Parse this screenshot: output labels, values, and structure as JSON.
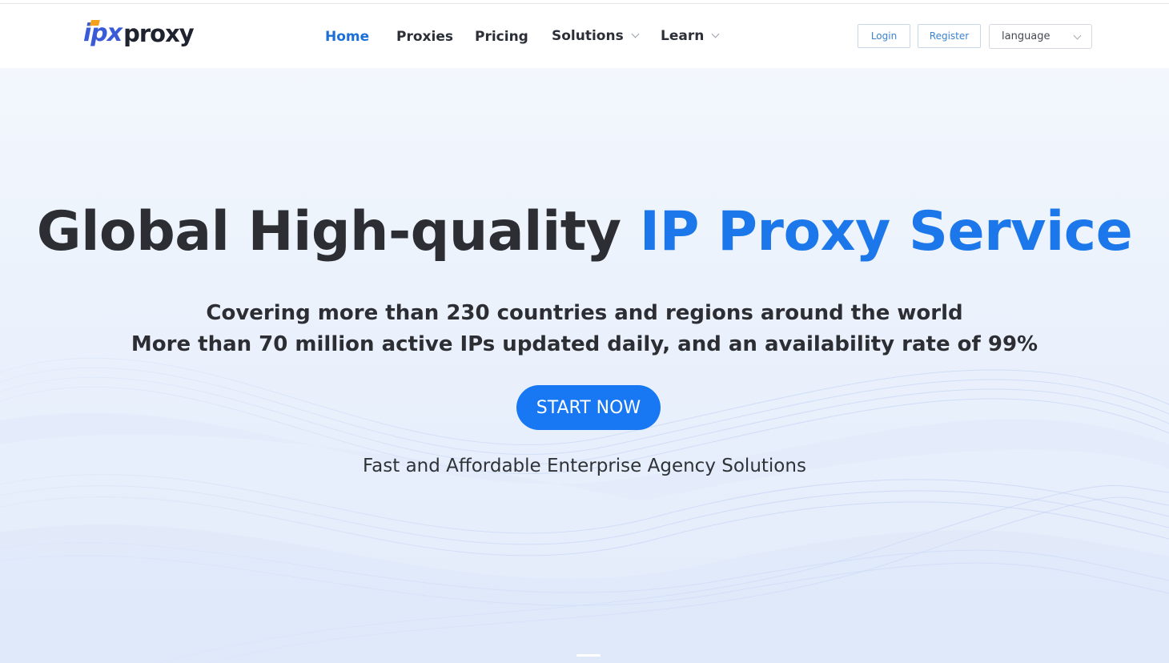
{
  "brand": {
    "logo_prefix": "ipx",
    "logo_suffix": "proxy",
    "prefix_color": "#3a5bd8",
    "dot_color": "#f5a21b"
  },
  "nav": {
    "home": "Home",
    "proxies": "Proxies",
    "pricing": "Pricing",
    "solutions": "Solutions",
    "learn": "Learn"
  },
  "auth": {
    "login": "Login",
    "register": "Register"
  },
  "language_select": {
    "value": "language"
  },
  "hero": {
    "title_part1": "Global High-quality ",
    "title_part2": "IP Proxy Service",
    "subtitle_line1": "Covering more than 230 countries and regions around the world",
    "subtitle_line2": "More than 70 million active IPs updated daily, and an availability rate of 99%",
    "cta": "START NOW",
    "tagline": "Fast and Affordable Enterprise Agency Solutions"
  },
  "colors": {
    "accent": "#1877f2",
    "title_accent": "#1c78ea",
    "nav_active": "#1c6fd8",
    "text_dark": "#2c2e33"
  },
  "icons": {
    "solutions_dropdown": "chevron-down-icon",
    "learn_dropdown": "chevron-down-icon",
    "language_dropdown": "chevron-down-icon"
  }
}
